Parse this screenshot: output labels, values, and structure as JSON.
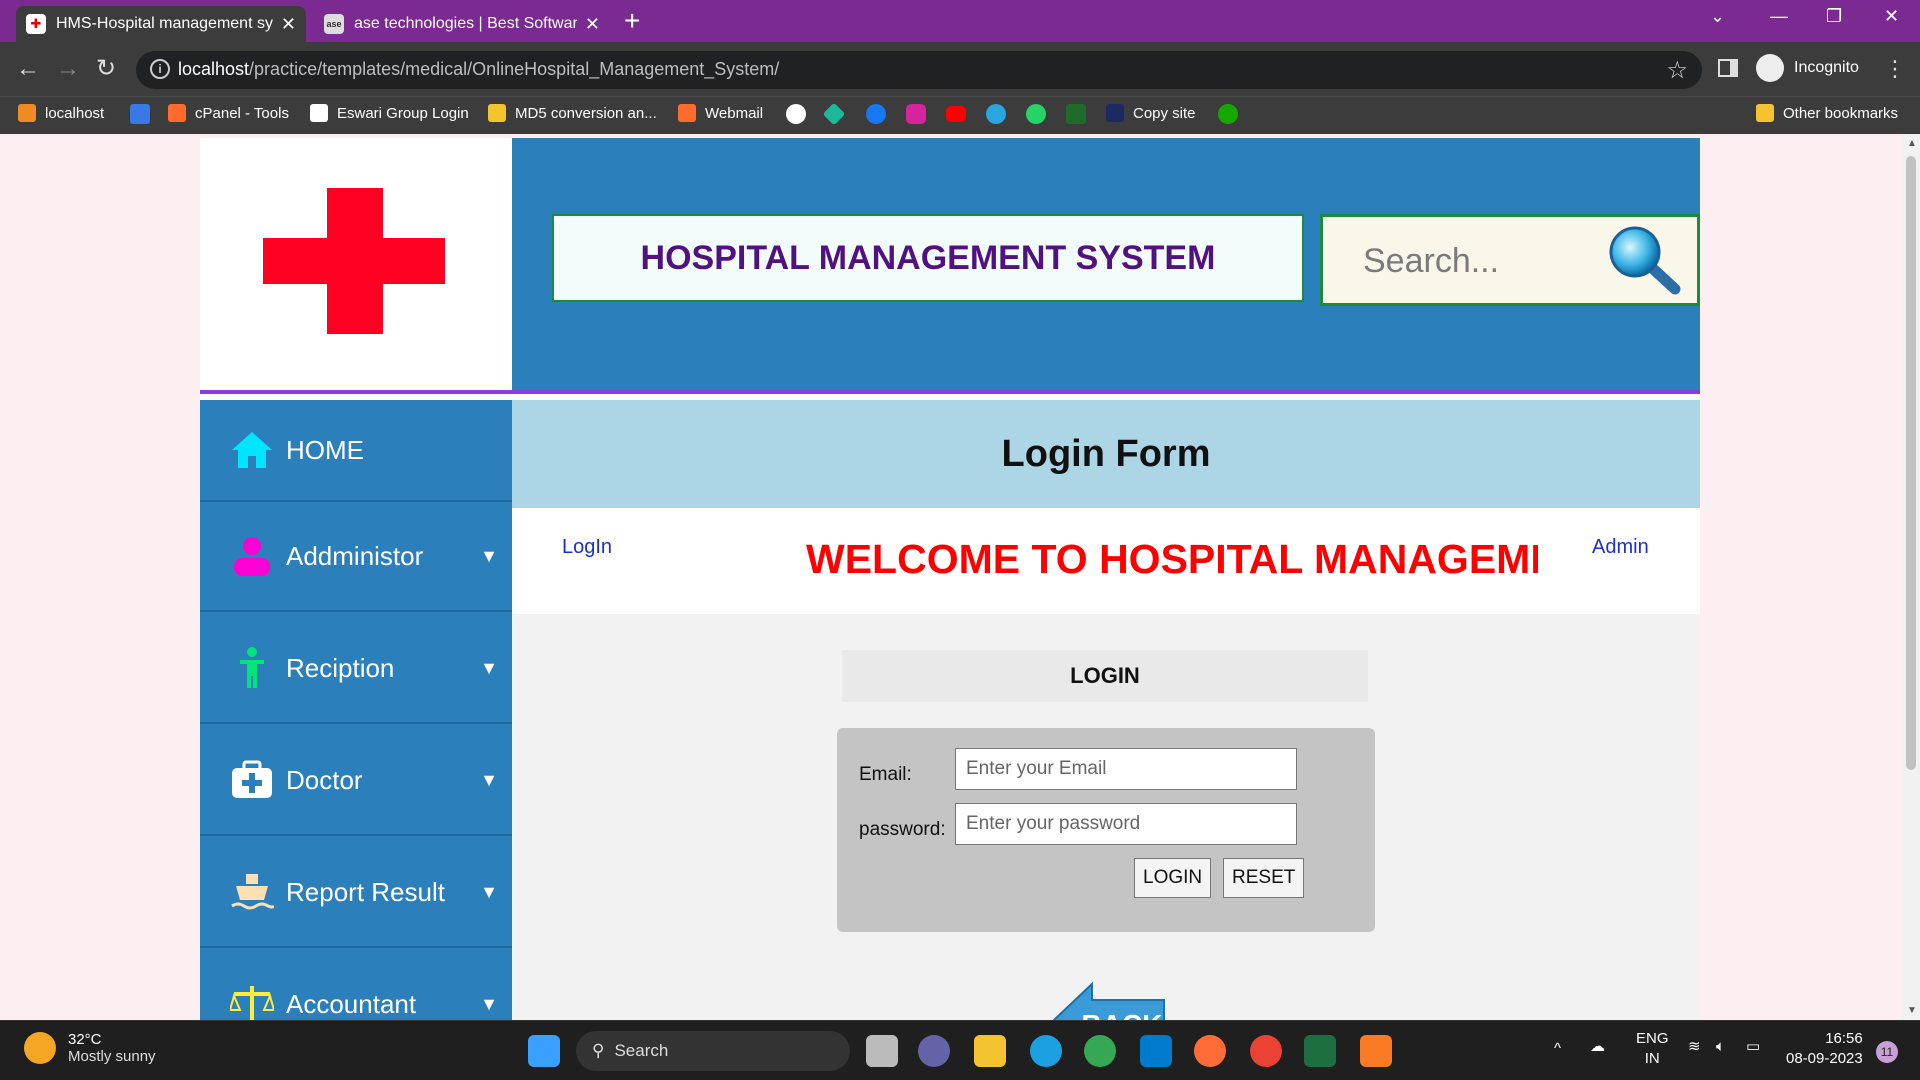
{
  "browser": {
    "tabs": [
      {
        "title": "HMS-Hospital management syste",
        "active": true
      },
      {
        "title": "ase technologies | Best Software",
        "active": false
      }
    ],
    "address": {
      "host": "localhost",
      "path": "/practice/templates/medical/OnlineHospital_Management_System/"
    },
    "profile_label": "Incognito",
    "bookmarks": [
      "localhost",
      "cPanel - Tools",
      "Eswari Group Login",
      "MD5 conversion an...",
      "Webmail",
      "Copy site"
    ],
    "other_bookmarks": "Other bookmarks"
  },
  "header": {
    "title": "HOSPITAL MANAGEMENT SYSTEM",
    "search_placeholder": "Search..."
  },
  "sidebar": {
    "items": [
      {
        "label": "HOME",
        "icon": "home-icon",
        "color": "#00e5ff"
      },
      {
        "label": "Addministor",
        "icon": "user-icon",
        "color": "#ff00d4"
      },
      {
        "label": "Reciption",
        "icon": "person-icon",
        "color": "#00e676"
      },
      {
        "label": "Doctor",
        "icon": "medical-kit-icon",
        "color": "#ffffff"
      },
      {
        "label": "Report Result",
        "icon": "ship-icon",
        "color": "#ffe0b2"
      },
      {
        "label": "Accountant",
        "icon": "scale-icon",
        "color": "#ffeb3b"
      }
    ],
    "caret": "▼"
  },
  "content": {
    "form_title": "Login Form",
    "link_login": "LogIn",
    "link_admin": "Admin",
    "marquee": "WELCOME TO HOSPITAL MANAGEMENT SYSTEM",
    "login_heading": "LOGIN",
    "email_label": "Email:",
    "email_placeholder": "Enter your Email",
    "password_label": "password:",
    "password_placeholder": "Enter your password",
    "login_button": "LOGIN",
    "reset_button": "RESET",
    "back_label": "BACK"
  },
  "taskbar": {
    "weather_temp": "32°C",
    "weather_desc": "Mostly sunny",
    "search_label": "Search",
    "lang1": "ENG",
    "lang2": "IN",
    "time": "16:56",
    "date": "08-09-2023",
    "notifications": "11"
  },
  "colors": {
    "header_blue": "#2b7fba",
    "title_text": "#51127f",
    "cross_red": "#ff0022",
    "marquee_red": "#ff0000",
    "tabbar_purple": "#7b2a92"
  }
}
